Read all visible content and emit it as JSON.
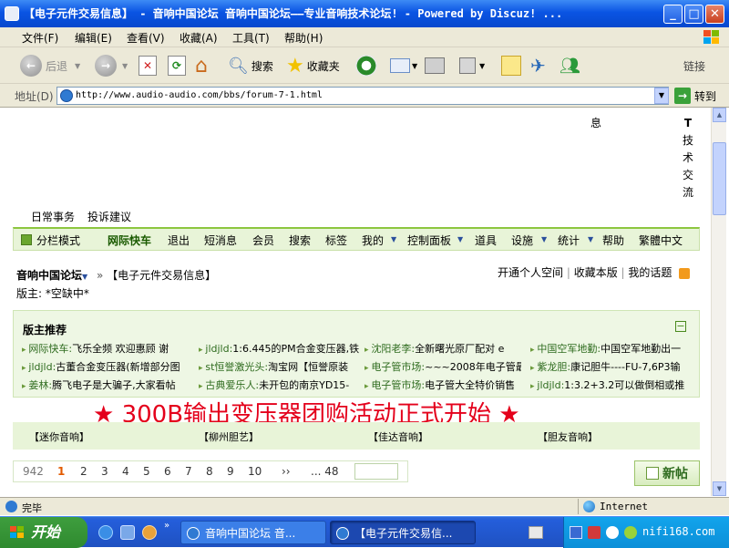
{
  "window": {
    "title": "【电子元件交易信息】 - 音响中国论坛 音响中国论坛——专业音响技术论坛! - Powered by Discuz! ..."
  },
  "menu": [
    "文件(F)",
    "编辑(E)",
    "查看(V)",
    "收藏(A)",
    "工具(T)",
    "帮助(H)"
  ],
  "toolbar": {
    "back": "后退",
    "search": "搜索",
    "favorites": "收藏夹",
    "links": "链接"
  },
  "address": {
    "label": "地址(D)",
    "url": "http://www.audio-audio.com/bbs/forum-7-1.html",
    "go": "转到"
  },
  "page": {
    "top_right_text": "息",
    "side_vertical": [
      "T",
      "技",
      "术",
      "交",
      "流"
    ],
    "links_row": [
      "日常事务",
      "投诉建议"
    ],
    "nav": [
      "分栏模式",
      "网际快车",
      "退出",
      "短消息",
      "会员",
      "搜索",
      "标签",
      "我的",
      "控制面板",
      "道具",
      "设施",
      "统计",
      "帮助",
      "繁體中文"
    ],
    "breadcrumb": {
      "home": "音响中国论坛",
      "sep": "»",
      "current": "【电子元件交易信息】"
    },
    "moderator": "版主: *空缺中*",
    "toplinks": [
      "开通个人空间",
      "收藏本版",
      "我的话题"
    ],
    "rec_title": "版主推荐",
    "rec_rows": [
      [
        {
          "who": "网际快车:",
          "text": "飞乐全频 欢迎惠顾 谢"
        },
        {
          "who": "jldjld:",
          "text": "1:6.445的PM合金变压器,铁"
        },
        {
          "who": "沈阳老李:",
          "text": "全新曙光原厂配对  e"
        },
        {
          "who": "中国空军地勤:",
          "text": "中国空军地勤出一"
        }
      ],
      [
        {
          "who": "jldjld:",
          "text": "古董合金变压器(新增部分图"
        },
        {
          "who": "st恒誉激光头:",
          "text": "淘宝网【恒誉原装"
        },
        {
          "who": "电子管市场:",
          "text": "~~~2008年电子管最"
        },
        {
          "who": "紫龙胆:",
          "text": "康记胆牛----FU-7,6P3输"
        }
      ],
      [
        {
          "who": "姜林:",
          "text": "腾飞电子是大骗子,大家看帖"
        },
        {
          "who": "古典爱乐人:",
          "text": "未开包的南京YD15-"
        },
        {
          "who": "电子管市场:",
          "text": "电子管大全特价销售"
        },
        {
          "who": "jldjld:",
          "text": "1:3.2+3.2可以做倒相或推"
        }
      ]
    ],
    "banner": "★ 300B输出变压器团购活动正式开始 ★",
    "ads": [
      "【迷你音响】",
      "【柳州胆艺】",
      "【佳达音响】",
      "【胆友音响】"
    ],
    "pager": {
      "total": "942",
      "current": "1",
      "pages": [
        "2",
        "3",
        "4",
        "5",
        "6",
        "7",
        "8",
        "9",
        "10"
      ],
      "next": "››",
      "last": "... 48"
    },
    "new_post": "新帖"
  },
  "status": {
    "text": "完毕",
    "zone": "Internet"
  },
  "taskbar": {
    "start": "开始",
    "tasks": [
      "音响中国论坛 音...",
      "【电子元件交易信..."
    ],
    "tray_text": "nifi168.com"
  },
  "colors": {
    "accent_green": "#8cc63f",
    "banner_red": "#e4001b",
    "current_page": "#e25a00"
  }
}
